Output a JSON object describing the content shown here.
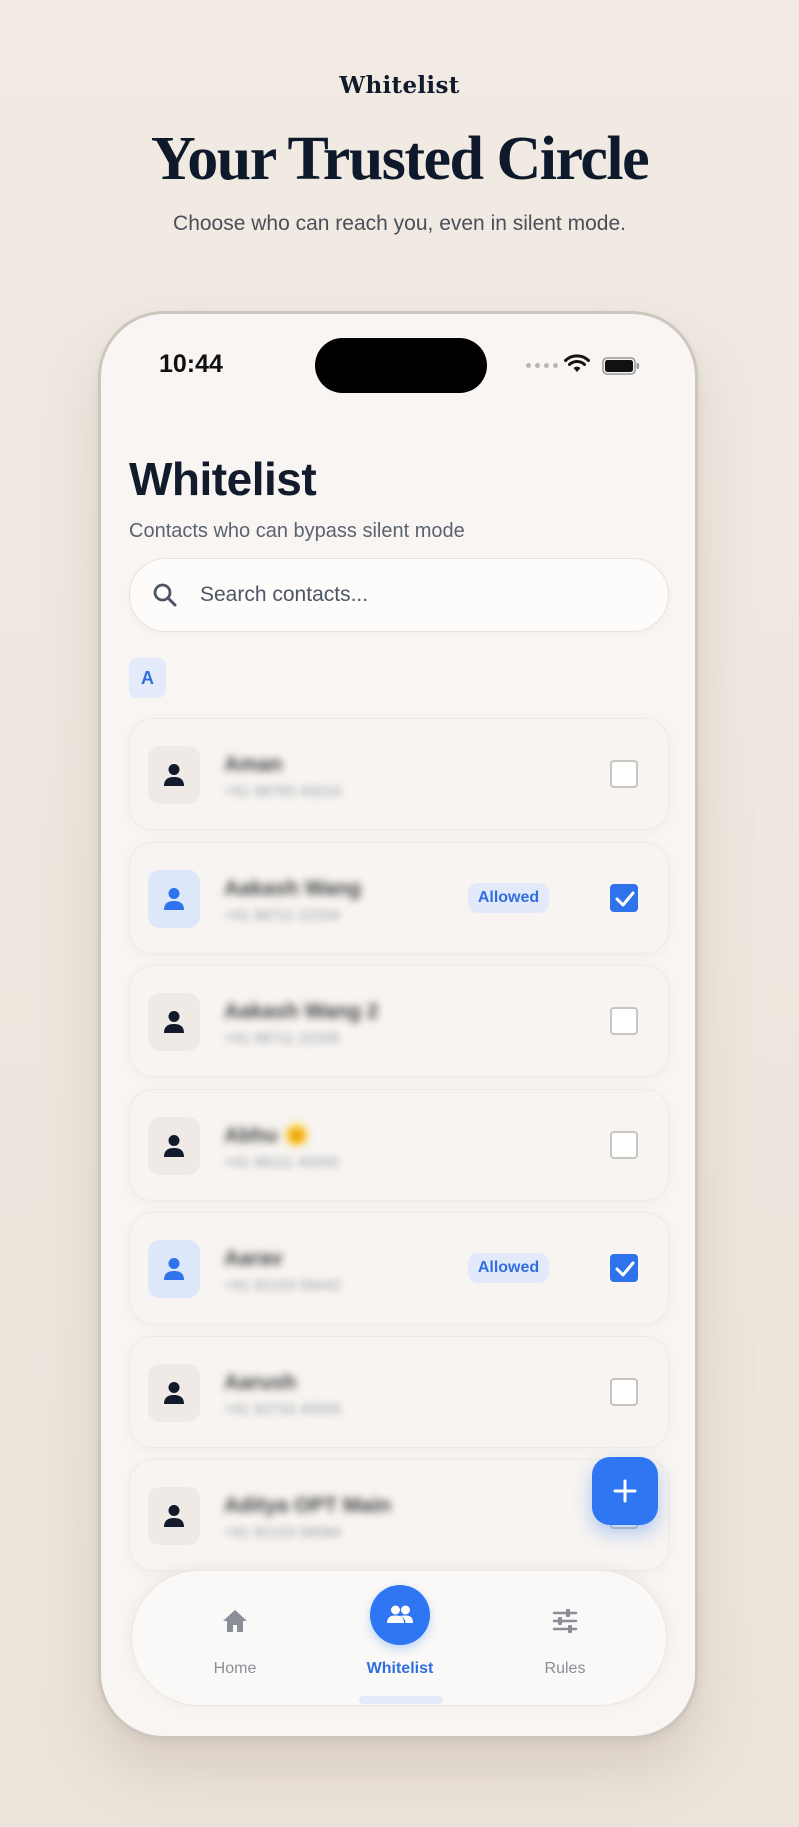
{
  "hero": {
    "kicker": "Whitelist",
    "title": "Your Trusted Circle",
    "subtitle": "Choose who can reach you, even in silent mode."
  },
  "status_bar": {
    "time": "10:44",
    "icons": [
      "signal-dots-icon",
      "wifi-icon",
      "battery-icon"
    ]
  },
  "screen": {
    "title": "Whitelist",
    "subtitle": "Contacts who can bypass silent mode",
    "search": {
      "placeholder": "Search contacts...",
      "value": "",
      "icon": "search-icon"
    },
    "section_letter": "A",
    "contacts": [
      {
        "name": "Aman",
        "phone": "+91 98765 43210",
        "allowed": false,
        "badge": ""
      },
      {
        "name": "Aakash Wang",
        "phone": "+91 98711 22334",
        "allowed": true,
        "badge": "Allowed"
      },
      {
        "name": "Aakash Wang 2",
        "phone": "+91 98711 22335",
        "allowed": false,
        "badge": ""
      },
      {
        "name": "Abhu 🌞",
        "phone": "+91 98111 45345",
        "allowed": false,
        "badge": ""
      },
      {
        "name": "Aarav",
        "phone": "+91 92103 56442",
        "allowed": true,
        "badge": "Allowed"
      },
      {
        "name": "Aarush",
        "phone": "+91 92733 45555",
        "allowed": false,
        "badge": ""
      },
      {
        "name": "Aditya OPT Main",
        "phone": "+91 92103 56584",
        "allowed": false,
        "badge": ""
      }
    ],
    "fab_icon": "plus-icon"
  },
  "tabbar": {
    "tabs": [
      {
        "label": "Home",
        "icon": "home-icon",
        "active": false
      },
      {
        "label": "Whitelist",
        "icon": "people-icon",
        "active": true
      },
      {
        "label": "Rules",
        "icon": "sliders-icon",
        "active": false
      }
    ]
  },
  "colors": {
    "accent": "#2E76F2",
    "background": "#F1EBE4",
    "card": "#F7F4F1",
    "title_text": "#0F1B2D"
  }
}
